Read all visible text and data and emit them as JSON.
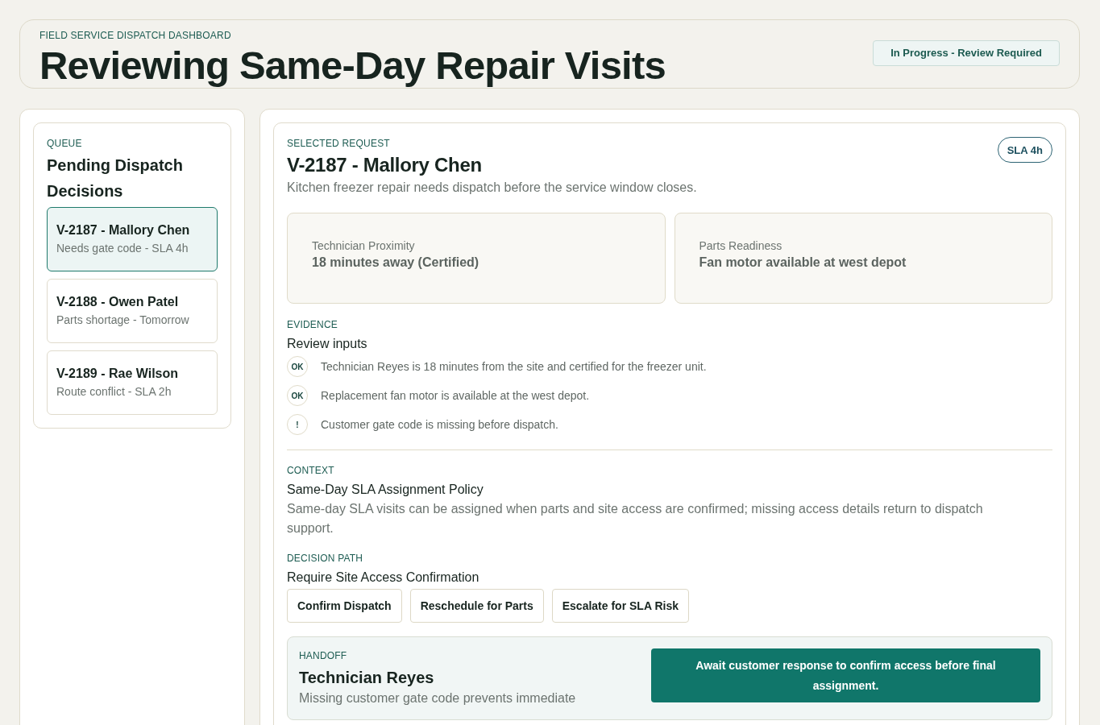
{
  "header": {
    "eyebrow": "FIELD SERVICE DISPATCH DASHBOARD",
    "title": "Reviewing Same-Day Repair Visits",
    "status": "In Progress - Review Required"
  },
  "queue": {
    "eyebrow": "QUEUE",
    "title": "Pending Dispatch Decisions",
    "items": [
      {
        "title": "V-2187 - Mallory Chen",
        "subtitle": "Needs gate code - SLA 4h",
        "selected": true
      },
      {
        "title": "V-2188 - Owen Patel",
        "subtitle": "Parts shortage - Tomorrow",
        "selected": false
      },
      {
        "title": "V-2189 - Rae Wilson",
        "subtitle": "Route conflict - SLA 2h",
        "selected": false
      }
    ]
  },
  "request": {
    "eyebrow": "SELECTED REQUEST",
    "title": "V-2187 - Mallory Chen",
    "description": "Kitchen freezer repair needs dispatch before the service window closes.",
    "sla": "SLA 4h",
    "metrics": [
      {
        "label": "Technician Proximity",
        "value": "18 minutes away (Certified)"
      },
      {
        "label": "Parts Readiness",
        "value": "Fan motor available at west depot"
      }
    ],
    "evidence": {
      "eyebrow": "EVIDENCE",
      "title": "Review inputs",
      "items": [
        {
          "mark": "OK",
          "text": "Technician Reyes is 18 minutes from the site and certified for the freezer unit."
        },
        {
          "mark": "OK",
          "text": "Replacement fan motor is available at the west depot."
        },
        {
          "mark": "!",
          "text": "Customer gate code is missing before dispatch."
        }
      ]
    },
    "context": {
      "eyebrow": "CONTEXT",
      "title": "Same-Day SLA Assignment Policy",
      "text": "Same-day SLA visits can be assigned when parts and site access are confirmed; missing access details return to dispatch support."
    },
    "decision": {
      "eyebrow": "DECISION PATH",
      "title": "Require Site Access Confirmation",
      "buttons": [
        "Confirm Dispatch",
        "Reschedule for Parts",
        "Escalate for SLA Risk"
      ]
    },
    "handoff": {
      "eyebrow": "HANDOFF",
      "title": "Technician Reyes",
      "text": "Missing customer gate code prevents immediate",
      "action": "Await customer response to confirm access before final assignment."
    }
  }
}
